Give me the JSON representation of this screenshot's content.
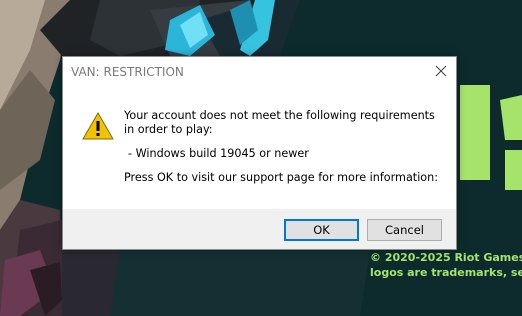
{
  "background": {
    "copyright_lines": [
      "© 2020-2025 Riot Games, I",
      "logos are trademarks, ser"
    ],
    "accent_color": "#a6e36b"
  },
  "dialog": {
    "title": "VAN: RESTRICTION",
    "icon": "warning-icon",
    "message_line1": "Your account does not meet the following requirements in order to play:",
    "requirement": " - Windows build 19045 or newer",
    "message_line2": "Press OK to visit our support page for more information:",
    "ok_label": "OK",
    "cancel_label": "Cancel"
  }
}
